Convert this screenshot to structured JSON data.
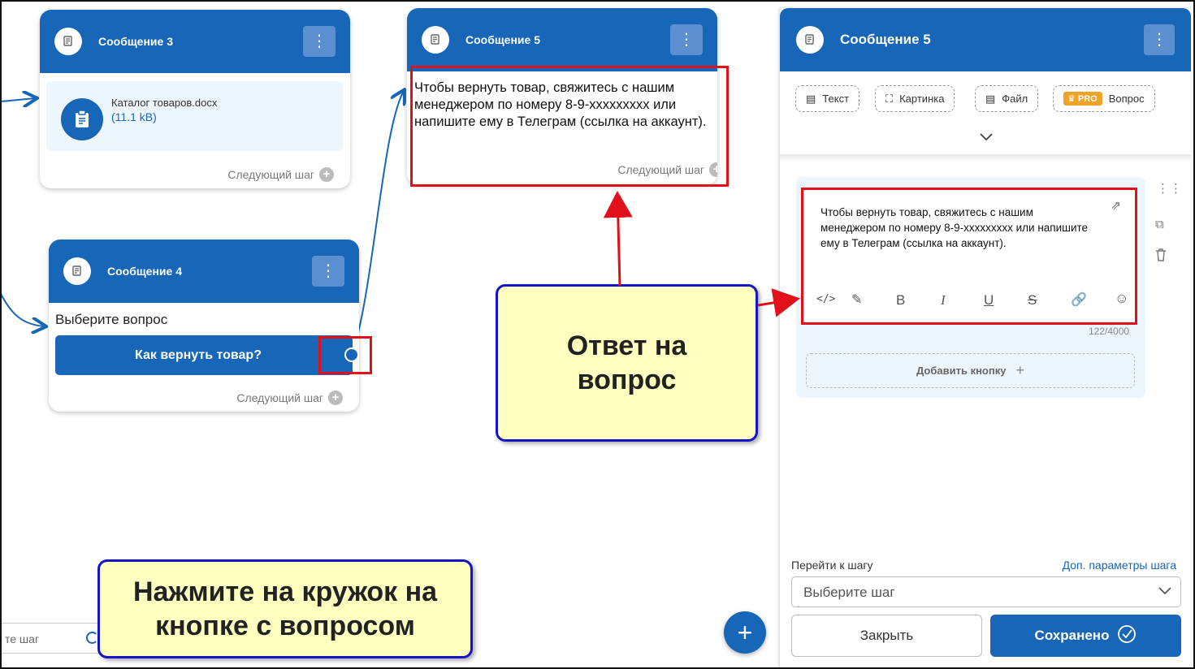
{
  "card3": {
    "title": "Сообщение 3",
    "file_name": "Каталог товаров.docx",
    "file_size": "(11.1 kB)",
    "next_step": "Следующий шаг"
  },
  "card4": {
    "title": "Сообщение 4",
    "prompt": "Выберите вопрос",
    "question_button": "Как вернуть товар?",
    "next_step": "Следующий шаг"
  },
  "card5": {
    "title": "Сообщение 5",
    "text": "Чтобы вернуть товар, свяжитесь с нашим менеджером по номеру 8-9-xxxxxxxxx или напишите ему в Телеграм (ссылка на аккаунт).",
    "next_step": "Следующий шаг"
  },
  "bottom_left": {
    "partial_label": "те шаг"
  },
  "callouts": {
    "answer": "Ответ на вопрос",
    "click_hint": "Нажмите на кружок на кнопке с вопросом"
  },
  "panel": {
    "title": "Сообщение 5",
    "chips": {
      "text": "Текст",
      "image": "Картинка",
      "file": "Файл",
      "pro_badge": "PRO",
      "question": "Вопрос"
    },
    "editor_text": "Чтобы вернуть товар, свяжитесь с нашим менеджером по номеру 8-9-xxxxxxxxx или напишите ему в Телеграм (ссылка на аккаунт).",
    "char_count": "122/4000",
    "add_button": "Добавить кнопку",
    "goto_label": "Перейти к шагу",
    "extra_params": "Доп. параметры шага",
    "step_select_placeholder": "Выберите шаг",
    "close_button": "Закрыть",
    "save_button": "Сохранено",
    "toolbar": {
      "bold": "B",
      "italic": "I",
      "underline": "U",
      "strike": "S"
    }
  },
  "colors": {
    "brand": "#1766b8",
    "callout_bg": "#ffffc0",
    "callout_border": "#1414c8",
    "highlight": "#e0111b"
  }
}
